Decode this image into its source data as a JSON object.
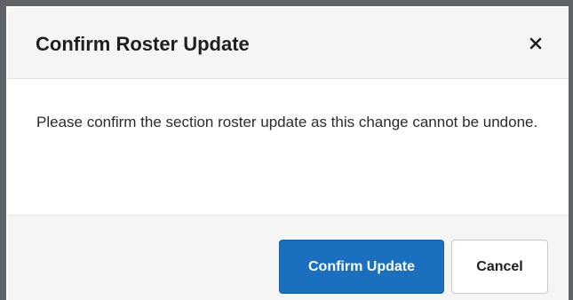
{
  "dialog": {
    "title": "Confirm Roster Update",
    "close_icon": "close-icon",
    "message": "Please confirm the section roster update as this change cannot be undone.",
    "buttons": {
      "confirm_label": "Confirm Update",
      "cancel_label": "Cancel"
    }
  },
  "colors": {
    "primary": "#1a6fbf",
    "header_bg": "#f5f5f5",
    "backdrop": "#5f6368"
  }
}
